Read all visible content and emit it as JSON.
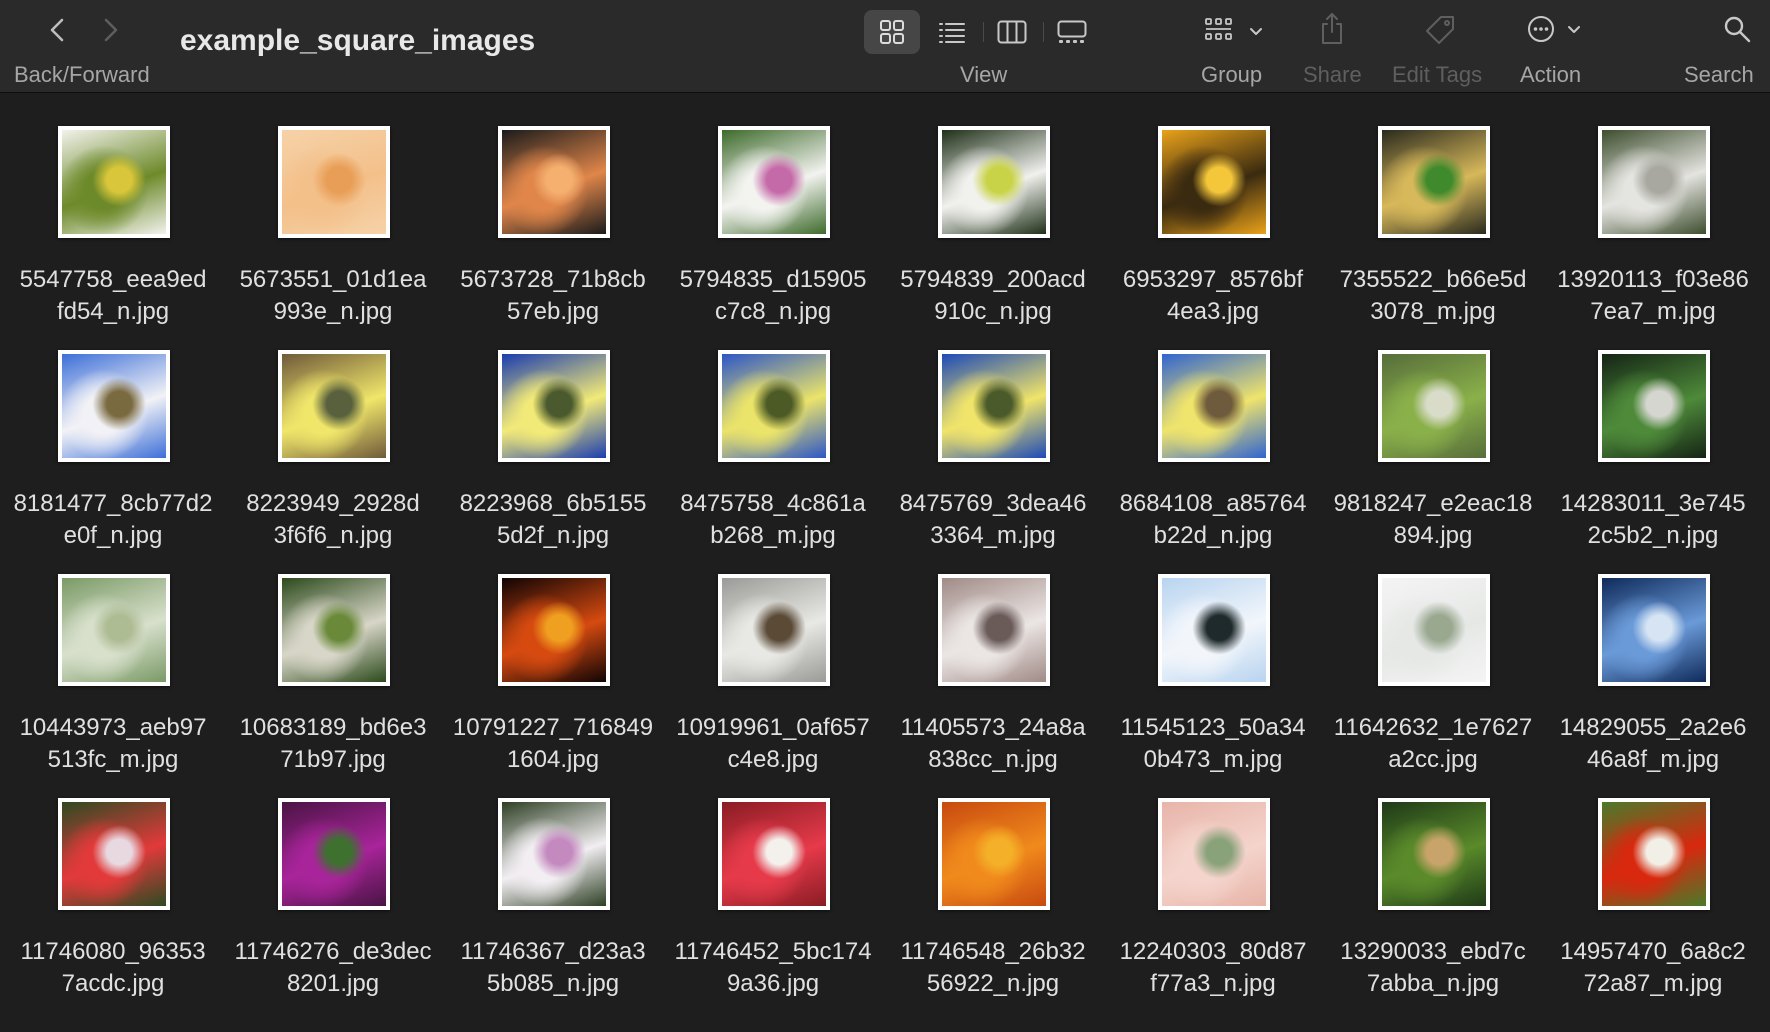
{
  "window": {
    "title": "example_square_images",
    "nav_label": "Back/Forward",
    "view_label": "View",
    "group_label": "Group",
    "share_label": "Share",
    "edit_tags_label": "Edit Tags",
    "action_label": "Action",
    "search_label": "Search"
  },
  "files": [
    {
      "name_line1": "5547758_eea9ed",
      "name_line2": "fd54_n.jpg",
      "colors": [
        "#f2f2ec",
        "#6d8a2a",
        "#d9c63a"
      ]
    },
    {
      "name_line1": "5673551_01d1ea",
      "name_line2": "993e_n.jpg",
      "colors": [
        "#f6d2a8",
        "#f3c08a",
        "#e89e56"
      ]
    },
    {
      "name_line1": "5673728_71b8cb",
      "name_line2": "57eb.jpg",
      "colors": [
        "#1b1b1b",
        "#e0864a",
        "#f5b070"
      ]
    },
    {
      "name_line1": "5794835_d15905",
      "name_line2": "c7c8_n.jpg",
      "colors": [
        "#3e6b2c",
        "#f3f3f0",
        "#c56aa8"
      ]
    },
    {
      "name_line1": "5794839_200acd",
      "name_line2": "910c_n.jpg",
      "colors": [
        "#1f3018",
        "#f1f1ee",
        "#c9d347"
      ]
    },
    {
      "name_line1": "6953297_8576bf",
      "name_line2": "4ea3.jpg",
      "colors": [
        "#e9a21a",
        "#3a2a10",
        "#f4c63a"
      ]
    },
    {
      "name_line1": "7355522_b66e5d",
      "name_line2": "3078_m.jpg",
      "colors": [
        "#2a2a1e",
        "#d7b85a",
        "#3f8a2c"
      ]
    },
    {
      "name_line1": "13920113_f03e86",
      "name_line2": "7ea7_m.jpg",
      "colors": [
        "#3e4e2e",
        "#e4e4e0",
        "#a8a8a0"
      ]
    },
    {
      "name_line1": "8181477_8cb77d2",
      "name_line2": "e0f_n.jpg",
      "colors": [
        "#3d6fd8",
        "#f2f2f6",
        "#7a6a40"
      ]
    },
    {
      "name_line1": "8223949_2928d",
      "name_line2": "3f6f6_n.jpg",
      "colors": [
        "#6f5a3a",
        "#f0e66a",
        "#58603e"
      ]
    },
    {
      "name_line1": "8223968_6b5155",
      "name_line2": "5d2f_n.jpg",
      "colors": [
        "#1b3db0",
        "#f2ea78",
        "#4a5a2e"
      ]
    },
    {
      "name_line1": "8475758_4c861a",
      "name_line2": "b268_m.jpg",
      "colors": [
        "#2d56c8",
        "#ebe46a",
        "#4c5a26"
      ]
    },
    {
      "name_line1": "8475769_3dea46",
      "name_line2": "3364_m.jpg",
      "colors": [
        "#1d4ab8",
        "#f0e46a",
        "#4a5a2a"
      ]
    },
    {
      "name_line1": "8684108_a85764",
      "name_line2": "b22d_n.jpg",
      "colors": [
        "#3064d0",
        "#efe46c",
        "#6e5a3c"
      ]
    },
    {
      "name_line1": "9818247_e2eac18",
      "name_line2": "894.jpg",
      "colors": [
        "#566d3a",
        "#8ab04a",
        "#d8dcc8"
      ]
    },
    {
      "name_line1": "14283011_3e745",
      "name_line2": "2c5b2_n.jpg",
      "colors": [
        "#142414",
        "#4e8a3a",
        "#d6d6d0"
      ]
    },
    {
      "name_line1": "10443973_aeb97",
      "name_line2": "513fc_m.jpg",
      "colors": [
        "#7a9a66",
        "#d8e0cc",
        "#aebc94"
      ]
    },
    {
      "name_line1": "10683189_bd6e3",
      "name_line2": "71b97.jpg",
      "colors": [
        "#2c4a1c",
        "#d8d6c8",
        "#6a8a3a"
      ]
    },
    {
      "name_line1": "10791227_716849",
      "name_line2": "1604.jpg",
      "colors": [
        "#100404",
        "#d64a10",
        "#f0a020"
      ]
    },
    {
      "name_line1": "10919961_0af657",
      "name_line2": "c4e8.jpg",
      "colors": [
        "#9a9a96",
        "#e8e8e4",
        "#5a4a36"
      ]
    },
    {
      "name_line1": "11405573_24a8a",
      "name_line2": "838cc_n.jpg",
      "colors": [
        "#a08a86",
        "#ebe6e4",
        "#6a5a58"
      ]
    },
    {
      "name_line1": "11545123_50a34",
      "name_line2": "0b473_m.jpg",
      "colors": [
        "#b8d4f0",
        "#f2f6fb",
        "#1e2a2c"
      ]
    },
    {
      "name_line1": "11642632_1e7627",
      "name_line2": "a2cc.jpg",
      "colors": [
        "#f4f4f4",
        "#e6e8e6",
        "#9aa890"
      ]
    },
    {
      "name_line1": "14829055_2a2e6",
      "name_line2": "46a8f_m.jpg",
      "colors": [
        "#0f2a5a",
        "#6a9ad8",
        "#d6e4f4"
      ]
    },
    {
      "name_line1": "11746080_96353",
      "name_line2": "7acdc.jpg",
      "colors": [
        "#2e4a22",
        "#e23a3a",
        "#e8d8e0"
      ]
    },
    {
      "name_line1": "11746276_de3dec",
      "name_line2": "8201.jpg",
      "colors": [
        "#4a1444",
        "#a8249a",
        "#3e7030"
      ]
    },
    {
      "name_line1": "11746367_d23a3",
      "name_line2": "5b085_n.jpg",
      "colors": [
        "#2e4024",
        "#f2eef2",
        "#c48ac0"
      ]
    },
    {
      "name_line1": "11746452_5bc174",
      "name_line2": "9a36.jpg",
      "colors": [
        "#8a1c24",
        "#e63a4a",
        "#f4f0ec"
      ]
    },
    {
      "name_line1": "11746548_26b32",
      "name_line2": "56922_n.jpg",
      "colors": [
        "#c84a10",
        "#f08a1c",
        "#f4b028"
      ]
    },
    {
      "name_line1": "12240303_80d87",
      "name_line2": "f77a3_n.jpg",
      "colors": [
        "#e8b4a8",
        "#f4d4cc",
        "#8aa27a"
      ]
    },
    {
      "name_line1": "13290033_ebd7c",
      "name_line2": "7abba_n.jpg",
      "colors": [
        "#1e3a18",
        "#5a8a2a",
        "#c8a46a"
      ]
    },
    {
      "name_line1": "14957470_6a8c2",
      "name_line2": "72a87_m.jpg",
      "colors": [
        "#4a7a2a",
        "#d8280e",
        "#f2f0e6"
      ]
    }
  ]
}
